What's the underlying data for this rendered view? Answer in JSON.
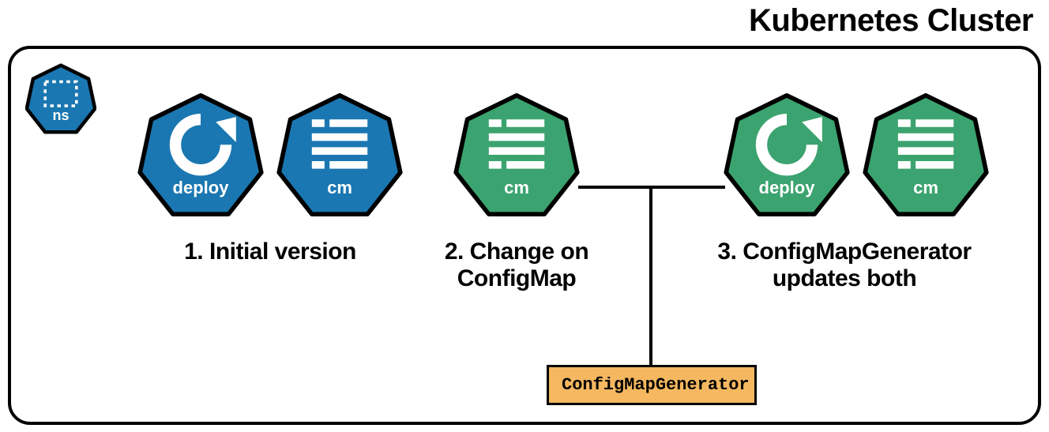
{
  "title": "Kubernetes Cluster",
  "heptagons": {
    "ns": {
      "label": "ns"
    },
    "deploy_blue": {
      "label": "deploy"
    },
    "cm_blue": {
      "label": "cm"
    },
    "cm_green1": {
      "label": "cm"
    },
    "deploy_green": {
      "label": "deploy"
    },
    "cm_green2": {
      "label": "cm"
    }
  },
  "captions": {
    "step1": "1. Initial version",
    "step2_line1": "2. Change on",
    "step2_line2": "ConfigMap",
    "step3_line1": "3. ConfigMapGenerator",
    "step3_line2": "updates both"
  },
  "generator": "ConfigMapGenerator",
  "colors": {
    "blue": "#1a77b1",
    "green": "#3ba36f",
    "orange": "#f5b860"
  }
}
